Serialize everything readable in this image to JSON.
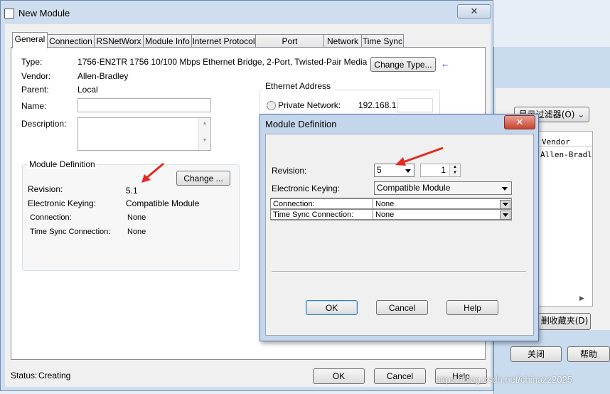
{
  "window": {
    "title": "New Module",
    "close_glyph": "✕",
    "tabs": [
      "General",
      "Connection",
      "RSNetWorx",
      "Module Info",
      "Internet Protocol",
      "Port Configuration",
      "Network",
      "Time Sync"
    ],
    "active_tab": "General"
  },
  "general": {
    "type_label": "Type:",
    "type_value": "1756-EN2TR 1756 10/100 Mbps Ethernet Bridge, 2-Port, Twisted-Pair Media",
    "change_type_button": "Change Type...",
    "vendor_label": "Vendor:",
    "vendor_value": "Allen-Bradley",
    "parent_label": "Parent:",
    "parent_value": "Local",
    "name_label": "Name:",
    "name_value": "",
    "description_label": "Description:",
    "description_value": ""
  },
  "ethernet_address": {
    "group_title": "Ethernet Address",
    "private_network_label": "Private Network:",
    "private_network_value": "192.168.1."
  },
  "module_definition_group": {
    "title": "Module Definition",
    "change_button": "Change ...",
    "revision_label": "Revision:",
    "revision_value": "5.1",
    "keying_label": "Electronic Keying:",
    "keying_value": "Compatible Module",
    "connection_label": "Connection:",
    "connection_value": "None",
    "timesync_label": "Time Sync Connection:",
    "timesync_value": "None"
  },
  "footer": {
    "status_label": "Status:",
    "status_value": "Creating",
    "ok_button": "OK",
    "cancel_button": "Cancel",
    "help_button": "Help"
  },
  "dialog": {
    "title": "Module Definition",
    "close_glyph": "✕",
    "revision_label": "Revision:",
    "revision_major": "5",
    "revision_minor": "1",
    "keying_label": "Electronic Keying:",
    "keying_value": "Compatible Module",
    "grid": [
      {
        "label": "Connection:",
        "value": "None"
      },
      {
        "label": "Time Sync Connection:",
        "value": "None"
      }
    ],
    "ok_button": "OK",
    "cancel_button": "Cancel",
    "help_button": "Help"
  },
  "background_window": {
    "filter_button": "显示过滤器(O)",
    "list_header": "Vendor",
    "list_row": "Allen-Bradley",
    "favorites_button": "删收藏夹(D)",
    "close_button": "关闭",
    "help_button": "帮助"
  },
  "watermark": "https://blog.csdn.net/chinazz2025",
  "colors": {
    "annotation_arrow": "#e8281f",
    "blue_arrow": "#1a2f8c",
    "title_bar": "#cfdeee",
    "dialog_close": "#c8442e"
  }
}
